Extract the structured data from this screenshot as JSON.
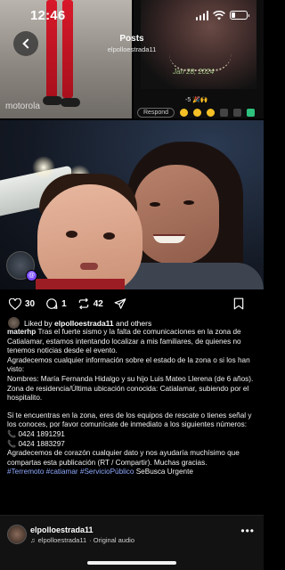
{
  "status_bar": {
    "time": "12:46",
    "battery_level": 0.25
  },
  "header": {
    "title": "Posts",
    "username": "elpolloestrada11"
  },
  "story_overlay": {
    "photo_date": "Jan 28, 2024",
    "reaction_text": "-5 🎉🙌",
    "respond_label": "Respond"
  },
  "motorola_label": "motorola",
  "actions": {
    "likes": "30",
    "comments": "1",
    "reposts": "42"
  },
  "liked_by": {
    "prefix": "Liked by",
    "user": "elpolloestrada11",
    "suffix": "and others"
  },
  "caption": {
    "user": "materhp",
    "p1": "Tras el fuerte sismo y la falta de comunicaciones en la zona de Catialamar, estamos intentando localizar a mis familiares, de quienes no tenemos noticias desde el evento.",
    "p2": "Agradecemos cualquier información sobre el estado de la zona o si los han visto:",
    "p3": "Nombres: María Fernanda Hidalgo y su hijo Luis Mateo Llerena (de 6 años).",
    "p4": "Zona de residencia/Última ubicación conocida: Catialamar, subiendo por el hospitalito.",
    "p5": "Si te encuentras en la zona, eres de los equipos de rescate o tienes señal y los conoces, por favor comunícate de inmediato a los siguientes números:",
    "phone1": "📞 0424 1891291",
    "phone2": "📞 0424 1883297",
    "p6": "Agradecemos de corazón cualquier dato y nos ayudaría muchísimo que compartas esta publicación (RT / Compartir). Muchas gracias.",
    "tags": "#Terremoto #catiamar #ServicioPúblico",
    "tags_end": "SeBusca Urgente"
  },
  "player": {
    "username": "elpolloestrada11",
    "audio_user": "elpolloestrada11",
    "audio_label": "· Original audio"
  },
  "colors": {
    "hashtag": "#8fa9ff",
    "background": "#000000",
    "accent_badge": "#7b4cff"
  }
}
